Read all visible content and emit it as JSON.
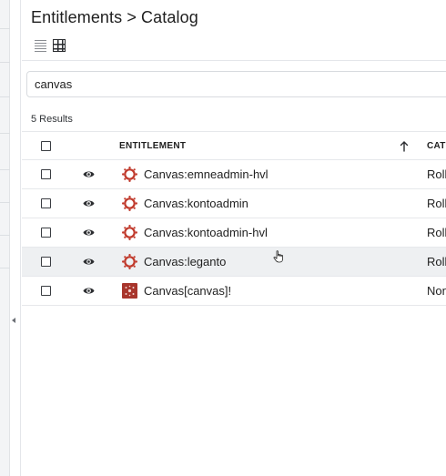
{
  "page": {
    "title": "Entitlements > Catalog"
  },
  "view_toggle": {
    "list_icon": "list-view-icon",
    "grid_icon": "grid-view-icon",
    "active": "grid"
  },
  "search": {
    "value": "canvas"
  },
  "results": {
    "count_label": "5 Results"
  },
  "table": {
    "columns": {
      "entitlement": "ENTITLEMENT",
      "category": "CATE"
    },
    "sort": {
      "column": "entitlement",
      "direction": "ascending",
      "icon": "arrow-up-icon"
    },
    "rows": [
      {
        "name": "Canvas:emneadmin-hvl",
        "category": "Rolle",
        "icon": "canvas-logo-icon",
        "hovered": false
      },
      {
        "name": "Canvas:kontoadmin",
        "category": "Rolle",
        "icon": "canvas-logo-icon",
        "hovered": false
      },
      {
        "name": "Canvas:kontoadmin-hvl",
        "category": "Rolle",
        "icon": "canvas-logo-icon",
        "hovered": false
      },
      {
        "name": "Canvas:leganto",
        "category": "Rolle",
        "icon": "canvas-logo-icon",
        "hovered": true
      },
      {
        "name": "Canvas[canvas]!",
        "category": "None",
        "icon": "canvas-square-icon",
        "hovered": false
      }
    ]
  },
  "colors": {
    "canvas_red": "#c0392b",
    "canvas_square": "#a8352c",
    "hover_row": "#eef0f2",
    "border": "#e6e8eb"
  }
}
